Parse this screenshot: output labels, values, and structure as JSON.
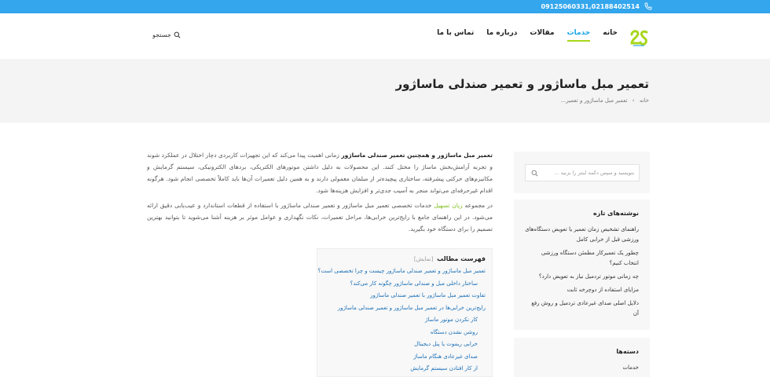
{
  "topbar": {
    "phone": "09125060331,02188402514",
    "phone_icon": "phone-icon"
  },
  "header": {
    "nav": [
      {
        "label": "خانه",
        "active": false
      },
      {
        "label": "خدمات",
        "active": true
      },
      {
        "label": "مقالات",
        "active": false
      },
      {
        "label": "درباره ما",
        "active": false
      },
      {
        "label": "تماس با ما",
        "active": false
      }
    ],
    "search_label": "جستجو"
  },
  "banner": {
    "title": "تعمیر مبل ماساژور و تعمیر صندلی ماساژور",
    "breadcrumb_home": "خانه",
    "breadcrumb_current": "تعمیر مبل ماساژور و تعمیر..."
  },
  "content": {
    "p1_strong": "تعمیر مبل ماساژور و همچنین تعمیر صندلی ماساژور",
    "p1_text": " زمانی اهمیت پیدا می‌کند که این تجهیزات کاربردی دچار اختلال در عملکرد شوند و تجربه آرامش‌بخش ماساژ را مختل کنند. این محصولات به دلیل داشتن موتورهای الکتریکی، بردهای الکترونیکی، سیستم گرمایش و مکانیزم‌های حرکتی پیشرفته، ساختاری پیچیده‌تر از مبلمان معمولی دارند و به همین دلیل تعمیرات آن‌ها باید کاملاً تخصصی انجام شود. هرگونه اقدام غیرحرفه‌ای می‌تواند منجر به آسیب جدی‌تر و افزایش هزینه‌ها شود.",
    "p2_a": "در مجموعه ",
    "p2_link": "زیان تسهیل",
    "p2_b": " خدمات تخصصی تعمیر مبل ماساژور و تعمیر صندلی ماساژور با استفاده از قطعات استاندارد و عیب‌یابی دقیق ارائه می‌شود. در این راهنمای جامع با رایج‌ترین خرابی‌ها، مراحل تعمیرات، نکات نگهداری و عوامل موثر بر هزینه آشنا می‌شوید تا بتوانید بهترین تصمیم را برای دستگاه خود بگیرید."
  },
  "toc": {
    "title": "فهرست مطالب",
    "toggle": "[نمایش]",
    "items": [
      {
        "label": "تعمیر مبل ماساژور و تعمیر صندلی ماساژور چیست و چرا تخصصی است؟",
        "level": 1
      },
      {
        "label": "ساختار داخلی مبل و صندلی ماساژور چگونه کار می‌کند؟",
        "level": 2
      },
      {
        "label": "تفاوت تعمیر مبل ماساژور با تعمیر صندلی ماساژور",
        "level": 1
      },
      {
        "label": "رایج‌ترین خرابی‌ها در تعمیر مبل ماساژور و تعمیر صندلی ماساژور",
        "level": 1
      },
      {
        "label": "کار نکردن موتور ماساژ",
        "level": 2
      },
      {
        "label": "روشن نشدن دستگاه",
        "level": 2
      },
      {
        "label": "خرابی ریموت یا پنل دیجیتال",
        "level": 2
      },
      {
        "label": "صدای غیرعادی هنگام ماساژ",
        "level": 2
      },
      {
        "label": "از کار افتادن سیستم گرمایش",
        "level": 2
      }
    ]
  },
  "sidebar": {
    "search_placeholder": "بنویسید و سپس دکمه اینتر را بزنید ...",
    "recent_title": "نوشته‌های تازه",
    "recent": [
      "راهنمای تشخیص زمان تعمیر یا تعویض دستگاه‌های ورزشی قبل از خرابی کامل",
      "چطور یک تعمیرکار مطمئن دستگاه ورزشی انتخاب کنیم؟",
      "چه زمانی موتور تردمیل نیاز به تعویض دارد؟",
      "مزایای استفاده از دوچرخه ثابت",
      "دلایل اصلی صدای غیرعادی تردمیل و روش رفع آن"
    ],
    "categories_title": "دسته‌ها",
    "categories": [
      "خدمات"
    ]
  },
  "colors": {
    "topbar": "#33a6ed",
    "nav_active": "#1aa8e6",
    "nav_underline": "#a8d61b",
    "toc_link": "#1a6fb7",
    "inline_link": "#7fbf1f"
  }
}
